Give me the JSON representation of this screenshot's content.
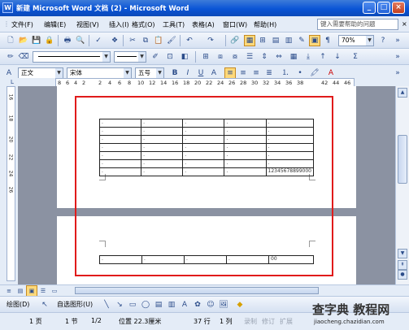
{
  "title": "新建 Microsoft Word 文档 (2) - Microsoft Word",
  "menu": [
    "文件(F)",
    "编辑(E)",
    "视图(V)",
    "插入(I)",
    "格式(O)",
    "工具(T)",
    "表格(A)",
    "窗口(W)",
    "帮助(H)"
  ],
  "help_placeholder": "键入需要帮助的问题",
  "zoom": "70%",
  "style_combo": "正文",
  "font_combo": "宋体",
  "size_combo": "五号",
  "format_buttons": [
    "B",
    "I",
    "U",
    "A"
  ],
  "ruler_numbers": [
    "8",
    "6",
    "4",
    "2",
    "2",
    "4",
    "6",
    "8",
    "10",
    "12",
    "14",
    "16",
    "18",
    "20",
    "22",
    "24",
    "26",
    "28",
    "30",
    "32",
    "34",
    "36",
    "38",
    "42",
    "44",
    "46"
  ],
  "vruler_numbers": [
    "16",
    "18",
    "20",
    "22",
    "24",
    "26"
  ],
  "table_cell_value": "12345678899000",
  "table2_cell_value": "00",
  "drawbar": {
    "draw_label": "绘图(D)",
    "autoshape_label": "自选图形(U)"
  },
  "status": {
    "page": "1 页",
    "section": "1 节",
    "pages": "1/2",
    "position": "位置 22.3厘米",
    "line": "37 行",
    "col": "1 列",
    "rec": "录制",
    "trk": "修订",
    "ext": "扩展"
  },
  "watermark": {
    "main": "查字典 教程网",
    "url": "jiaocheng.chazidian.com"
  },
  "colors": {
    "title_blue": "#0a54d6",
    "highlight": "#e01b1b",
    "page_bg": "#8b92a2"
  }
}
